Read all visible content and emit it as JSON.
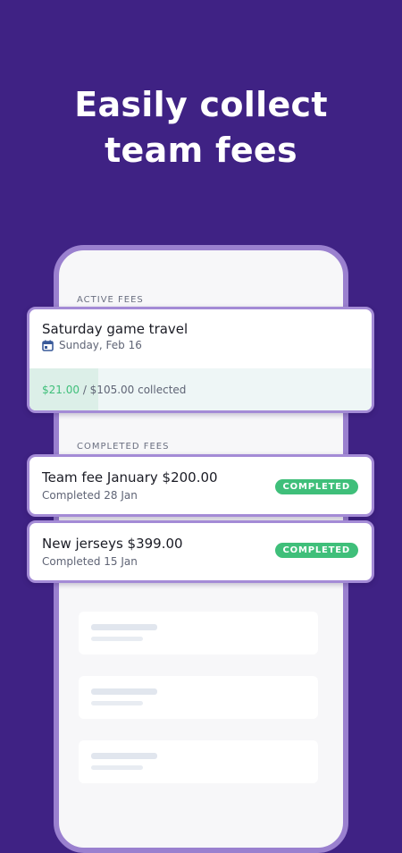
{
  "headline": {
    "line1": "Easily collect",
    "line2": "team fees"
  },
  "active_section": {
    "label": "ACTIVE FEES",
    "fee": {
      "title": "Saturday game travel",
      "date": "Sunday, Feb 16",
      "date_icon": "calendar-icon",
      "collected_amount": "$21.00",
      "collected_rest": " / $105.00 collected",
      "progress_fraction": 0.2
    }
  },
  "completed_section": {
    "label": "COMPLETED FEES",
    "fees": [
      {
        "title": "Team fee January $200.00",
        "status_text": "Completed 28 Jan",
        "badge": "COMPLETED"
      },
      {
        "title": "New jerseys $399.00",
        "status_text": "Completed 15 Jan",
        "badge": "COMPLETED"
      }
    ]
  },
  "colors": {
    "background": "#3f2284",
    "phone_frame": "#9a80cf",
    "card_border": "#a48bd6",
    "accent_green": "#3fbf7a"
  }
}
